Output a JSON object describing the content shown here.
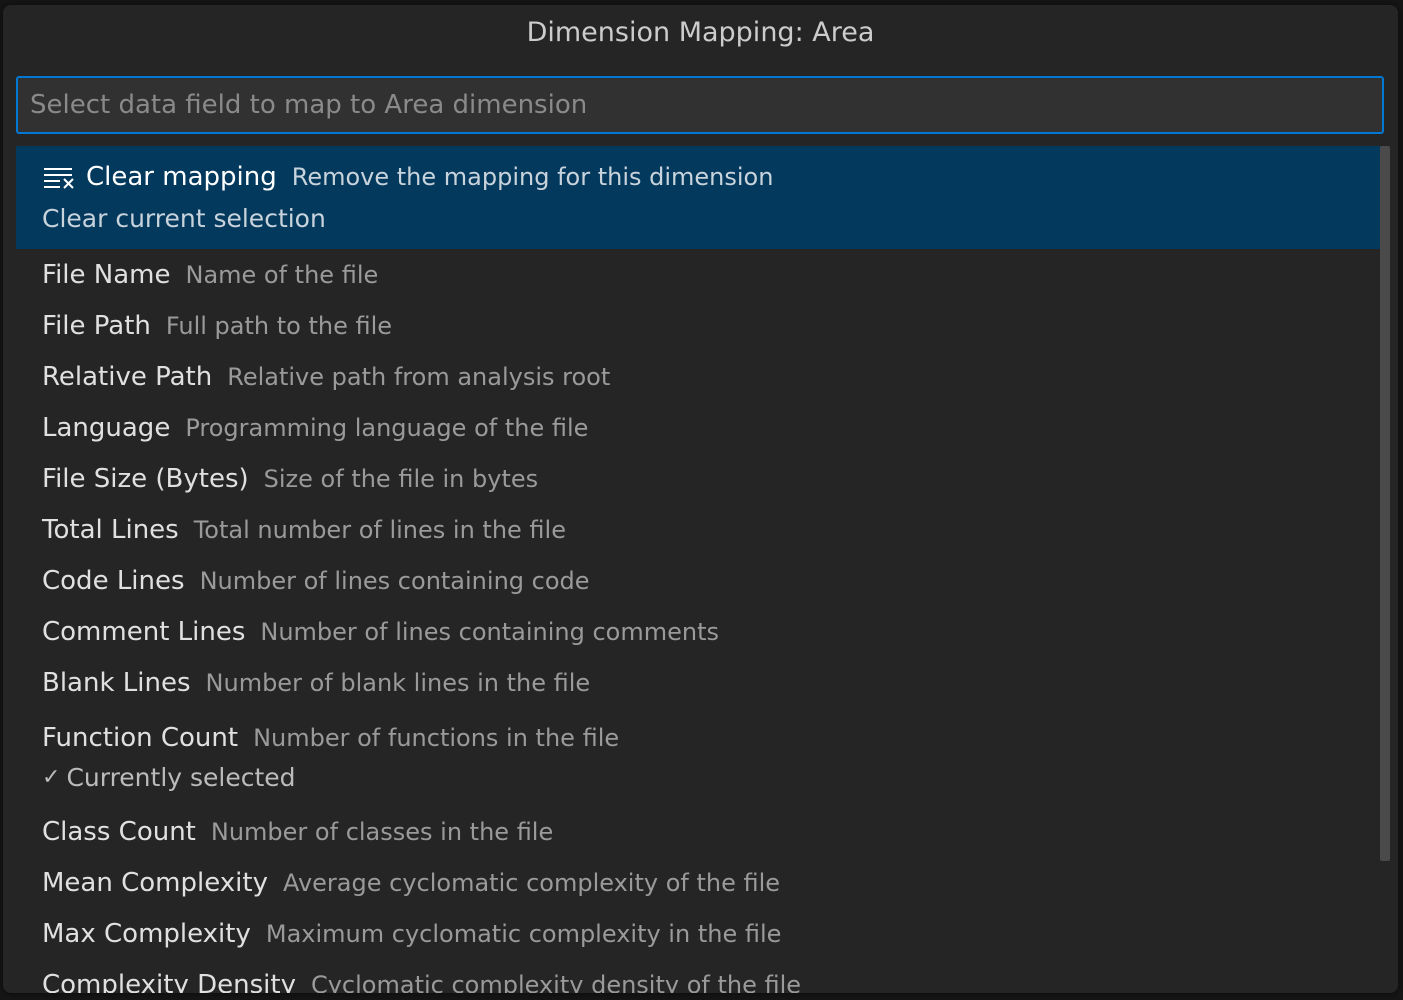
{
  "title": "Dimension Mapping: Area",
  "input": {
    "placeholder": "Select data field to map to Area dimension",
    "value": ""
  },
  "clear_item": {
    "icon": "clear-all-icon",
    "label": "Clear mapping",
    "description": "Remove the mapping for this dimension",
    "detail": "Clear current selection"
  },
  "items": [
    {
      "label": "File Name",
      "description": "Name of the file"
    },
    {
      "label": "File Path",
      "description": "Full path to the file"
    },
    {
      "label": "Relative Path",
      "description": "Relative path from analysis root"
    },
    {
      "label": "Language",
      "description": "Programming language of the file"
    },
    {
      "label": "File Size (Bytes)",
      "description": "Size of the file in bytes"
    },
    {
      "label": "Total Lines",
      "description": "Total number of lines in the file"
    },
    {
      "label": "Code Lines",
      "description": "Number of lines containing code"
    },
    {
      "label": "Comment Lines",
      "description": "Number of lines containing comments"
    },
    {
      "label": "Blank Lines",
      "description": "Number of blank lines in the file"
    }
  ],
  "selected_item": {
    "label": "Function Count",
    "description": "Number of functions in the file",
    "detail": "Currently selected",
    "icon": "check-icon"
  },
  "more_items": [
    {
      "label": "Class Count",
      "description": "Number of classes in the file"
    },
    {
      "label": "Mean Complexity",
      "description": "Average cyclomatic complexity of the file"
    },
    {
      "label": "Max Complexity",
      "description": "Maximum cyclomatic complexity in the file"
    },
    {
      "label": "Complexity Density",
      "description": "Cyclomatic complexity density of the file"
    }
  ],
  "colors": {
    "accent": "#0078d4",
    "focus_background": "#04395e",
    "panel_background": "#252526"
  }
}
